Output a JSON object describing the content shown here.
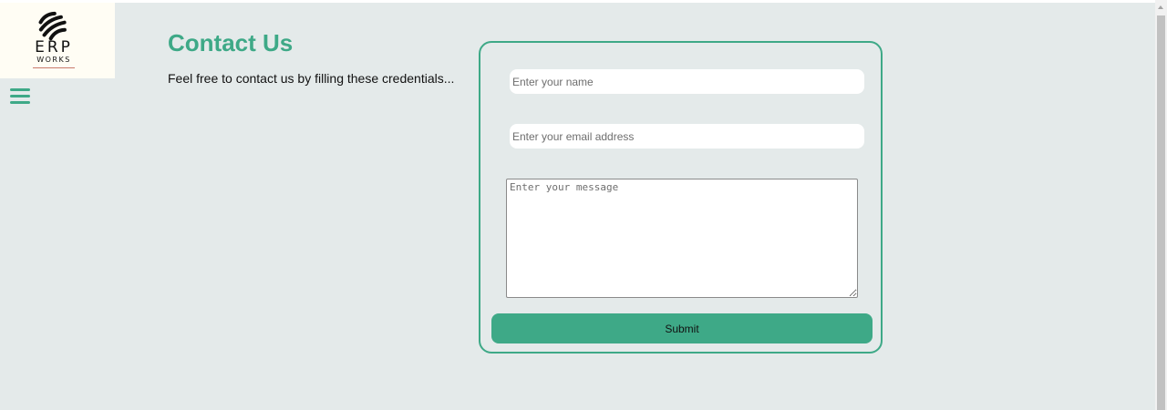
{
  "logo": {
    "brand": "ERP",
    "tagline": "WORKS",
    "icon": "stripes-logo-icon"
  },
  "nav": {
    "menu_icon": "hamburger-menu-icon"
  },
  "header": {
    "title": "Contact Us",
    "subtitle": "Feel free to contact us by filling these credentials..."
  },
  "form": {
    "name_placeholder": "Enter your name",
    "email_placeholder": "Enter your email address",
    "message_placeholder": "Enter your message",
    "submit_label": "Submit"
  },
  "colors": {
    "accent": "#3ea987",
    "background": "#e4eaea",
    "logo_background": "#fffdf4"
  }
}
